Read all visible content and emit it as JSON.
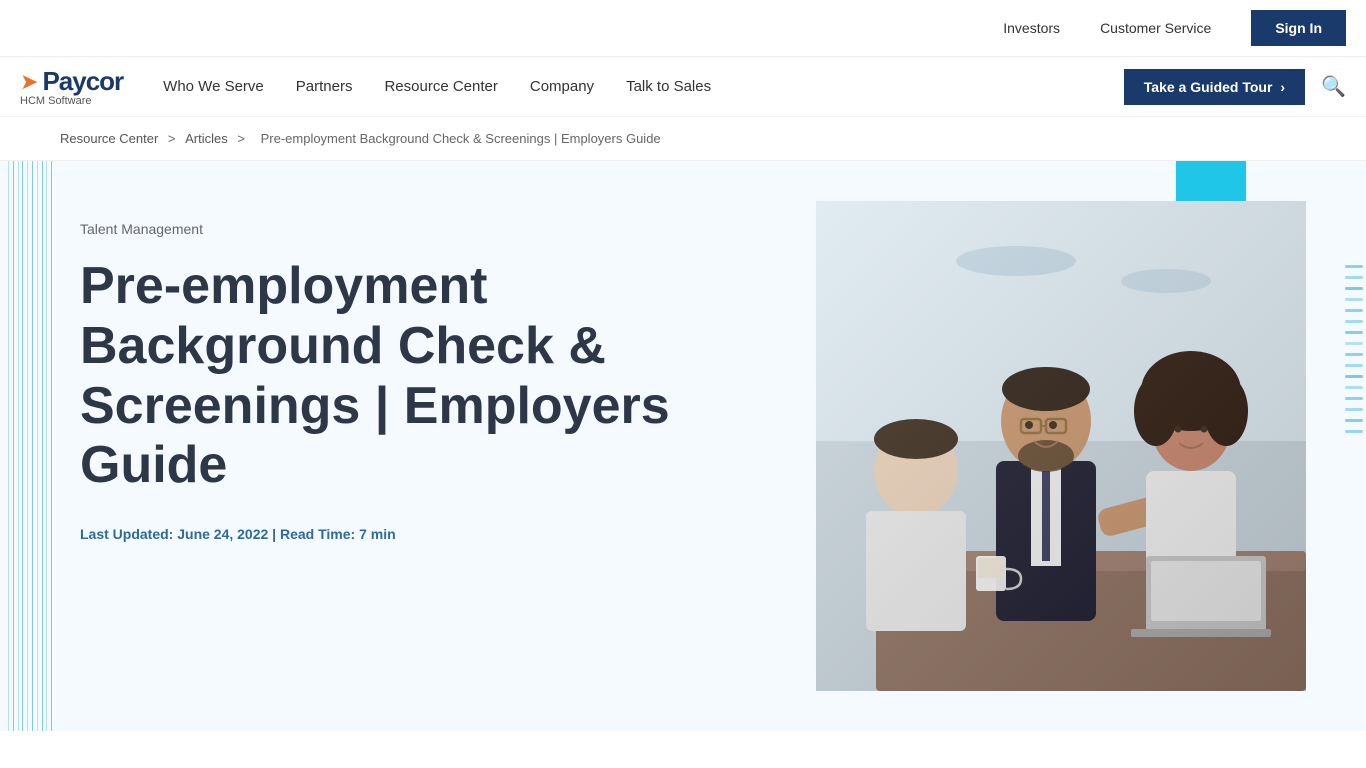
{
  "utility": {
    "investors_label": "Investors",
    "customer_service_label": "Customer Service",
    "sign_in_label": "Sign In"
  },
  "logo": {
    "company_name": "Paycor",
    "tagline": "HCM Software"
  },
  "nav": {
    "items": [
      {
        "label": "Who We Serve"
      },
      {
        "label": "Partners"
      },
      {
        "label": "Resource Center"
      },
      {
        "label": "Company"
      },
      {
        "label": "Talk to Sales"
      }
    ],
    "guided_tour_label": "Take a Guided Tour"
  },
  "breadcrumb": {
    "items": [
      {
        "label": "Resource Center",
        "href": "#"
      },
      {
        "label": "Articles",
        "href": "#"
      },
      {
        "label": "Pre-employment Background Check & Screenings | Employers Guide",
        "href": "#"
      }
    ],
    "separator": ">"
  },
  "article": {
    "category": "Talent Management",
    "title": "Pre-employment Background Check & Screenings | Employers Guide",
    "meta": "Last Updated: June 24, 2022 | Read Time: 7 min"
  }
}
